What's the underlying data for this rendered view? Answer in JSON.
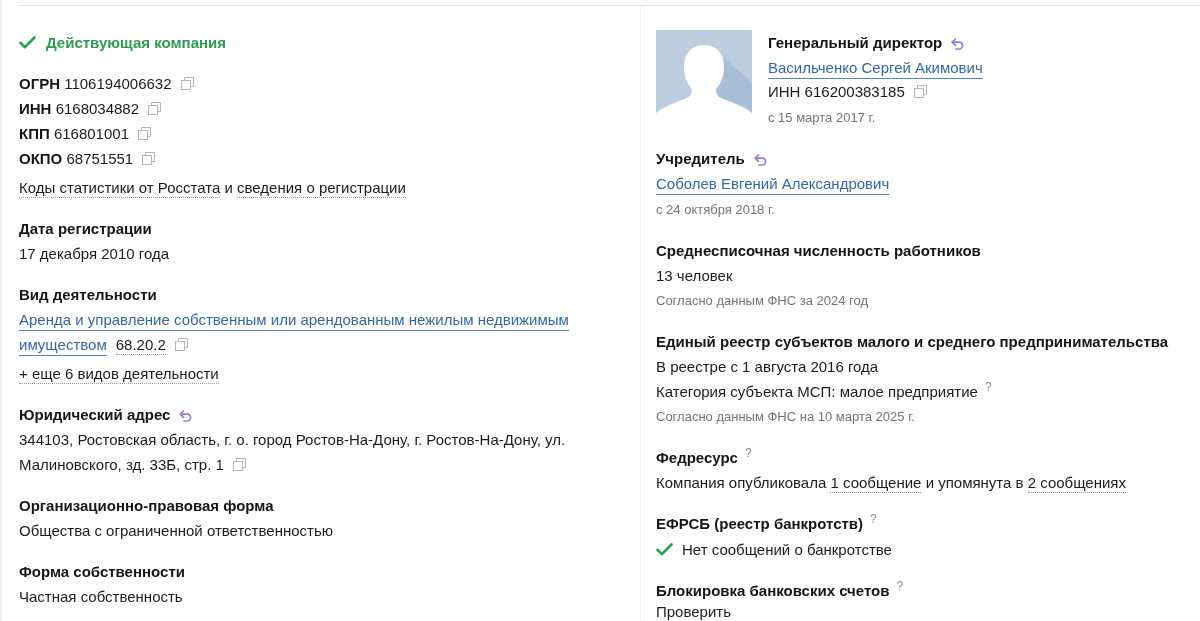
{
  "status": {
    "label": "Действующая компания"
  },
  "identifiers": [
    {
      "label": "ОГРН",
      "value": "1106194006632",
      "copyable": true
    },
    {
      "label": "ИНН",
      "value": "6168034882",
      "copyable": true
    },
    {
      "label": "КПП",
      "value": "616801001",
      "copyable": true
    },
    {
      "label": "ОКПО",
      "value": "68751551",
      "copyable": true
    }
  ],
  "registry_links": [
    {
      "text": "Коды статистики от Росстата",
      "link": true
    },
    {
      "text": "и",
      "link": false
    },
    {
      "text": "сведения о регистрации",
      "link": true
    }
  ],
  "left_sections": [
    {
      "title": "Дата регистрации",
      "history": false,
      "lines": [
        {
          "kind": "text",
          "text": "17 декабря 2010 года"
        }
      ]
    },
    {
      "title": "Вид деятельности",
      "history": false,
      "lines": [
        {
          "kind": "activity",
          "name_lines": [
            "Аренда и управление собственным или арендованным нежилым недвижимым",
            "имуществом"
          ],
          "code": "68.20.2",
          "copyable": true
        },
        {
          "kind": "more",
          "text": "+ еще 6 видов деятельности"
        }
      ]
    },
    {
      "title": "Юридический адрес",
      "history": true,
      "lines": [
        {
          "kind": "address",
          "text_lines": [
            "344103, Ростовская область, г. о. город Ростов-На-Дону, г. Ростов-На-Дону, ул.",
            "Малиновского, зд. 33Б, стр. 1"
          ],
          "copyable": true
        }
      ]
    },
    {
      "title": "Организационно-правовая форма",
      "history": false,
      "lines": [
        {
          "kind": "text",
          "text": "Общества с ограниченной ответственностью"
        }
      ]
    },
    {
      "title": "Форма собственности",
      "history": false,
      "lines": [
        {
          "kind": "text",
          "text": "Частная собственность"
        }
      ]
    }
  ],
  "director": {
    "title": "Генеральный директор",
    "history": true,
    "name": "Васильченко Сергей Акимович",
    "inn": "ИНН 616200383185",
    "inn_copyable": true,
    "since": "с 15 марта 2017 г."
  },
  "right_sections": [
    {
      "title": "Учредитель",
      "history": true,
      "lines": [
        {
          "kind": "person",
          "text": "Соболев Евгений Александрович"
        },
        {
          "kind": "note",
          "text": "с 24 октября 2018 г."
        }
      ]
    },
    {
      "title": "Среднесписочная численность работников",
      "history": false,
      "lines": [
        {
          "kind": "text",
          "text": "13 человек"
        },
        {
          "kind": "note",
          "text": "Согласно данным ФНС за 2024 год"
        }
      ]
    },
    {
      "title": "Единый реестр субъектов малого и среднего предпринимательства",
      "history": false,
      "lines": [
        {
          "kind": "text",
          "text": "В реестре с 1 августа 2016 года"
        },
        {
          "kind": "text",
          "text": "Категория субъекта МСП: малое предприятие",
          "hint": "?"
        },
        {
          "kind": "note",
          "text": "Согласно данным ФНС на 10 марта 2025 г."
        }
      ]
    },
    {
      "title": "Федресурс",
      "history": false,
      "hint": "?",
      "lines": [
        {
          "kind": "sentence",
          "parts": [
            {
              "text": "Компания опубликовала",
              "link": false
            },
            {
              "text": "1 сообщение",
              "link": true
            },
            {
              "text": "и упомянута в",
              "link": false
            },
            {
              "text": "2 сообщениях",
              "link": true
            }
          ]
        }
      ]
    },
    {
      "title": "ЕФРСБ (реестр банкротств)",
      "history": false,
      "hint": "?",
      "lines": [
        {
          "kind": "check",
          "text": "Нет сообщений о банкротстве"
        }
      ]
    },
    {
      "title": "Блокировка банковских счетов",
      "history": false,
      "hint": "?",
      "lines": [
        {
          "kind": "action",
          "text": "Проверить"
        }
      ]
    }
  ]
}
